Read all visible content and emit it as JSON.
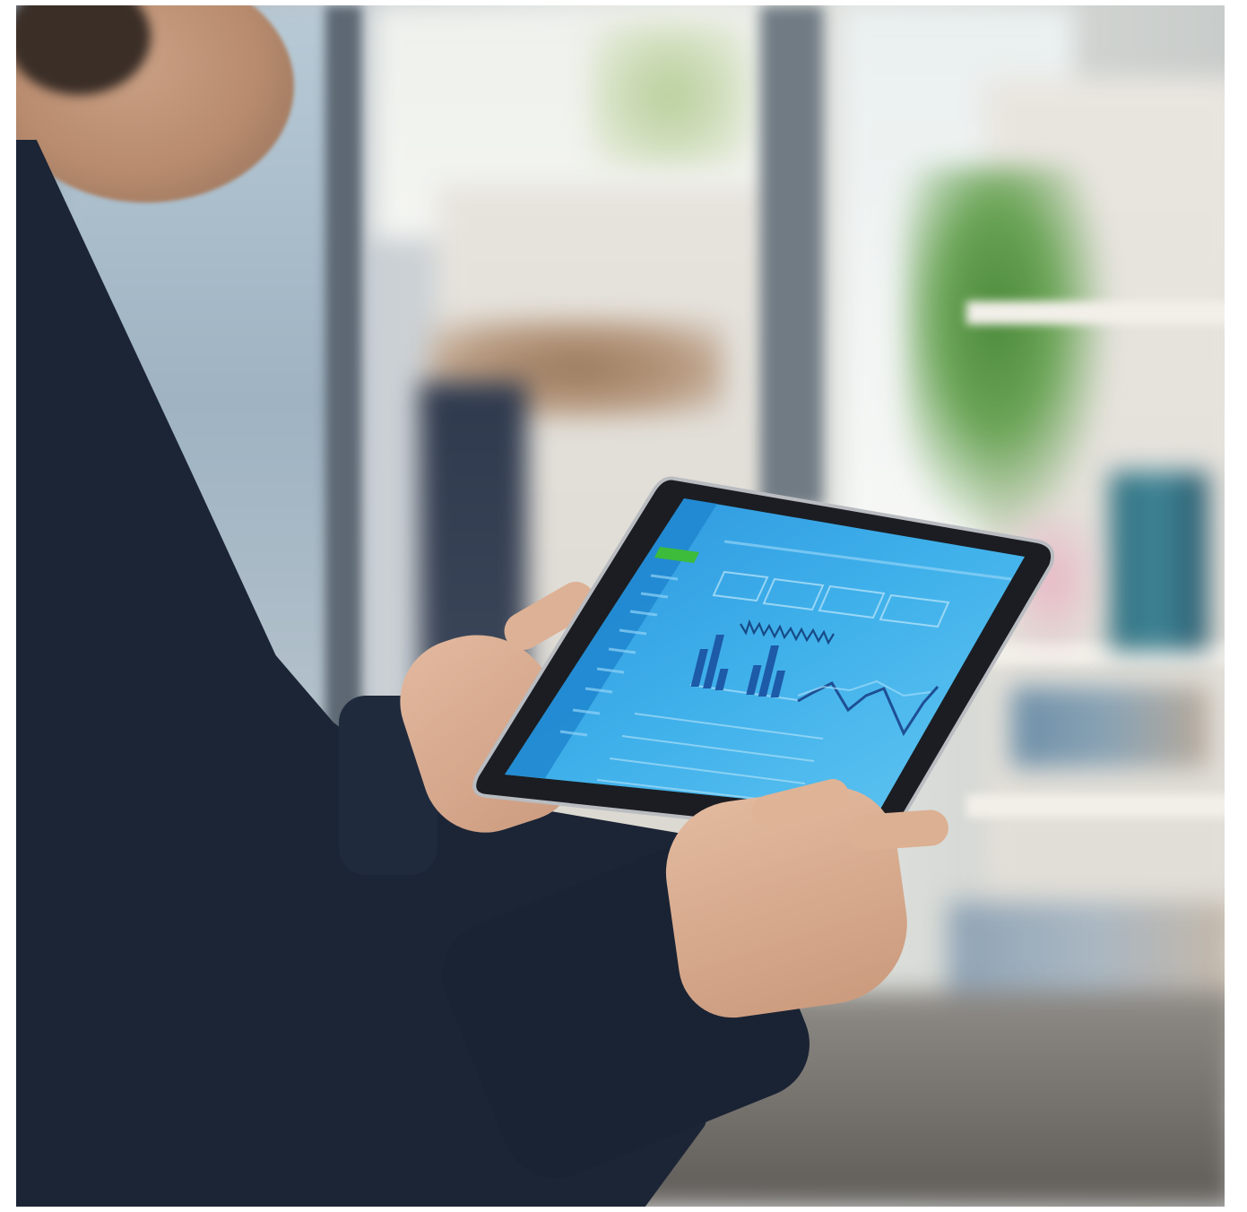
{
  "scene": {
    "subject": "",
    "colors": {
      "screen": "#2d9fe0",
      "screen_light": "#5cc0f0",
      "sidebar": "#1f86cf",
      "active_item": "#3dbb3a",
      "bars": "#1d5aa8",
      "line": "#1e4f93",
      "bezel": "#1b1d22",
      "sweater": "#1c2535"
    },
    "icons": [
      "bar-chart-icon",
      "line-chart-icon"
    ]
  }
}
